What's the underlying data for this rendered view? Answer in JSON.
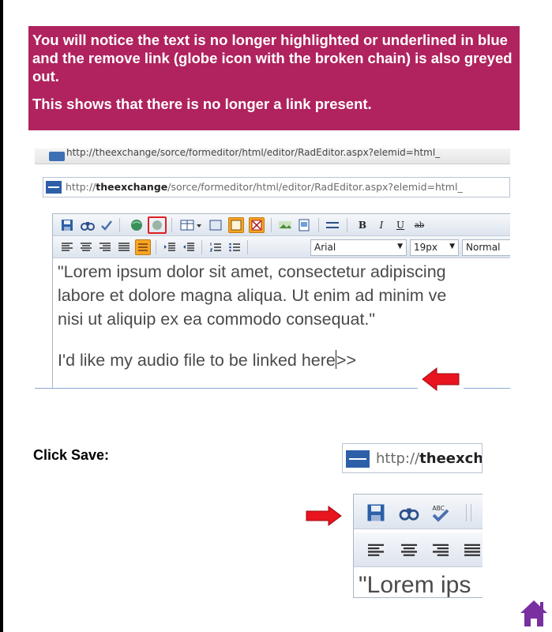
{
  "callout": {
    "text1": "You will notice the text is no longer highlighted or underlined in blue and the remove link (globe icon with the broken chain) is also greyed out.",
    "text2": "This shows that there is no longer a link present."
  },
  "screenshot1": {
    "top_url": "http://theexchange/sorce/formeditor/html/editor/RadEditor.aspx?elemid=html_",
    "url_prefix": "http://",
    "url_host": "theexchange",
    "url_path": "/sorce/formeditor/html/editor/RadEditor.aspx?elemid=html_",
    "font_name": "Arial",
    "font_size": "19px",
    "paragraph_style": "Normal",
    "body_line1": "\"Lorem ipsum dolor sit amet, consectetur adipiscing",
    "body_line2": "labore et dolore magna aliqua. Ut enim ad minim ve",
    "body_line3": "nisi ut aliquip ex ea commodo consequat.\"",
    "body_line4": "I'd like my audio file to be linked here",
    "body_line4_tail": ">>"
  },
  "instruction": {
    "click_save": "Click Save:"
  },
  "screenshot2": {
    "url_prefix": "http://",
    "url_host": "theexch",
    "body_text": "\"Lorem ips"
  },
  "colors": {
    "callout_bg": "#b0235e",
    "arrow_red": "#e8141e",
    "home_purple": "#7a2fa0"
  },
  "icons": [
    "save-icon",
    "find-icon",
    "spellcheck-icon",
    "hyperlink-icon",
    "remove-link-icon",
    "table-icon",
    "image-icon",
    "align-left-icon",
    "home-icon"
  ]
}
